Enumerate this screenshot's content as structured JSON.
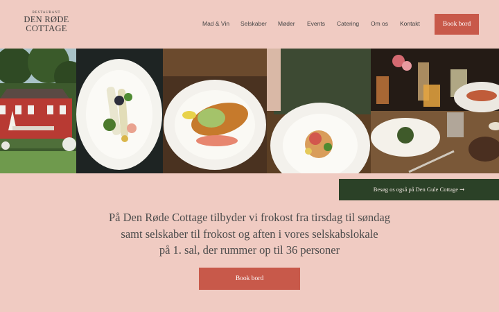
{
  "logo": {
    "small": "RESTAURANT",
    "line1": "DEN RØDE",
    "line2": "COTTAGE"
  },
  "nav": [
    "Mad & Vin",
    "Selskaber",
    "Møder",
    "Events",
    "Catering",
    "Om os",
    "Kontakt"
  ],
  "header": {
    "book_label": "Book bord"
  },
  "banner": {
    "visit_label": "Besøg os også på Den Gule Cottage ➞"
  },
  "intro": {
    "line1": "På Den Røde Cottage tilbyder vi frokost fra tirsdag til søndag",
    "line2": "samt selskaber til frokost og aften i vores selskabslokale",
    "line3": "på 1. sal, der rummer op til 36 personer"
  },
  "cta": {
    "book_label": "Book bord"
  },
  "colors": {
    "background": "#f0cbc2",
    "accent": "#c8594a",
    "dark_green": "#2b4127"
  }
}
